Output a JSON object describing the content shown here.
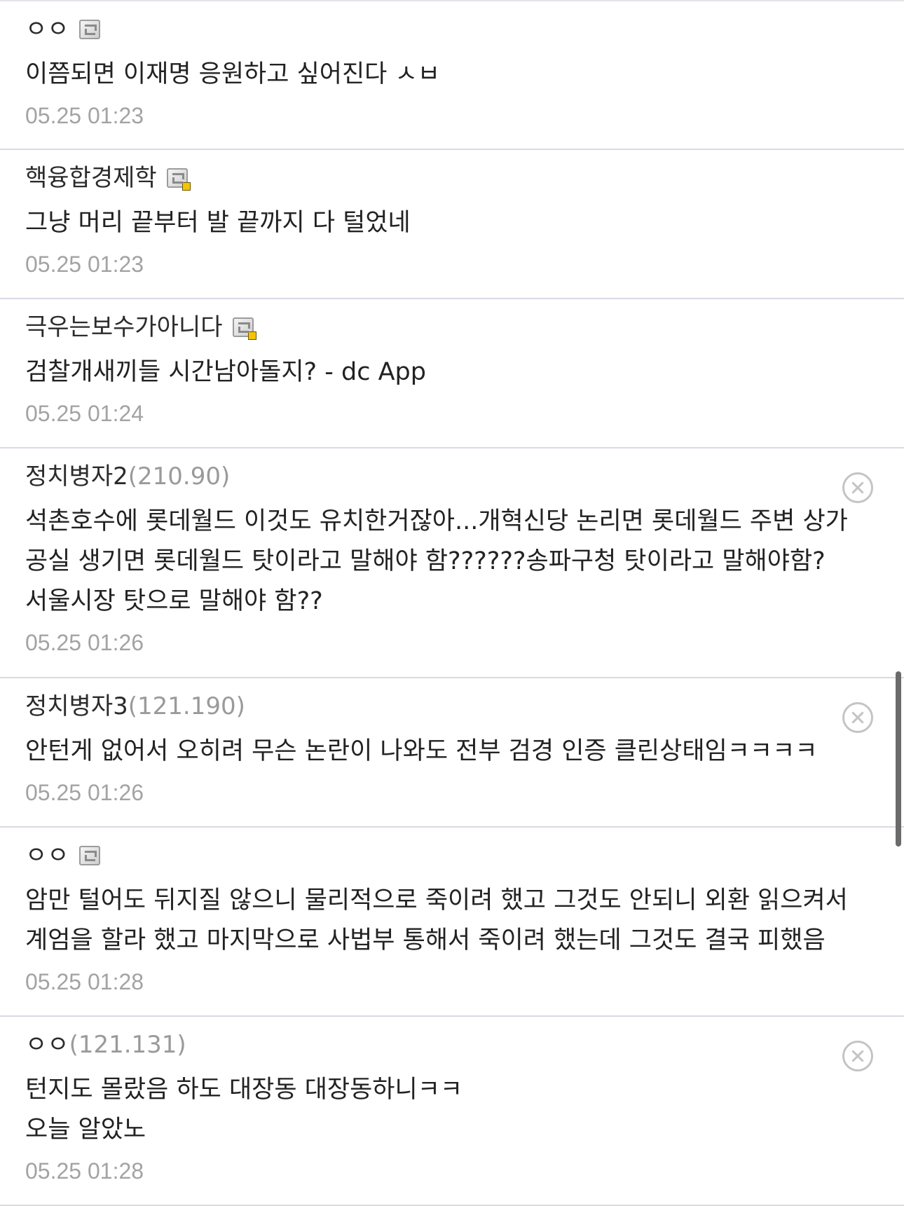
{
  "comments": [
    {
      "author": "ㅇㅇ",
      "ip": "",
      "body": "이쯤되면 이재명 응원하고 싶어진다 ㅅㅂ",
      "date": "05.25 01:23",
      "member_icon": "gallery-member-icon"
    },
    {
      "author": "핵융합경제학",
      "ip": "",
      "body": "그냥 머리 끝부터 발 끝까지 다 털었네",
      "date": "05.25 01:23",
      "member_icon": "fixed-member-icon"
    },
    {
      "author": "극우는보수가아니다",
      "ip": "",
      "body": "검찰개새끼들 시간남아돌지? - dc App",
      "date": "05.25 01:24",
      "member_icon": "fixed-member-icon"
    },
    {
      "author": "정치병자2",
      "ip": "(210.90)",
      "body": "석촌호수에 롯데월드 이것도 유치한거잖아...개혁신당 논리면 롯데월드 주변 상가 공실 생기면 롯데월드 탓이라고 말해야 함??????송파구청 탓이라고 말해야함? 서울시장 탓으로 말해야 함??",
      "date": "05.25 01:26",
      "delete_icon": "close-circle-icon"
    },
    {
      "author": "정치병자3",
      "ip": "(121.190)",
      "body": "안턴게 없어서 오히려 무슨 논란이 나와도 전부 검경 인증 클린상태임ㅋㅋㅋㅋ",
      "date": "05.25 01:26",
      "delete_icon": "close-circle-icon"
    },
    {
      "author": "ㅇㅇ",
      "ip": "",
      "body": "암만 털어도 뒤지질 않으니 물리적으로 죽이려 했고 그것도 안되니 외환 읽으켜서 계엄을 할라 했고 마지막으로 사법부 통해서 죽이려 했는데 그것도 결국 피했음",
      "date": "05.25 01:28",
      "member_icon": "gallery-member-icon"
    },
    {
      "author": "ㅇㅇ",
      "ip": "(121.131)",
      "body_lines": [
        "턴지도 몰랐음 하도 대장동 대장동하니ㅋㅋ",
        "오늘 알았노"
      ],
      "date": "05.25 01:28",
      "delete_icon": "close-circle-icon"
    }
  ]
}
